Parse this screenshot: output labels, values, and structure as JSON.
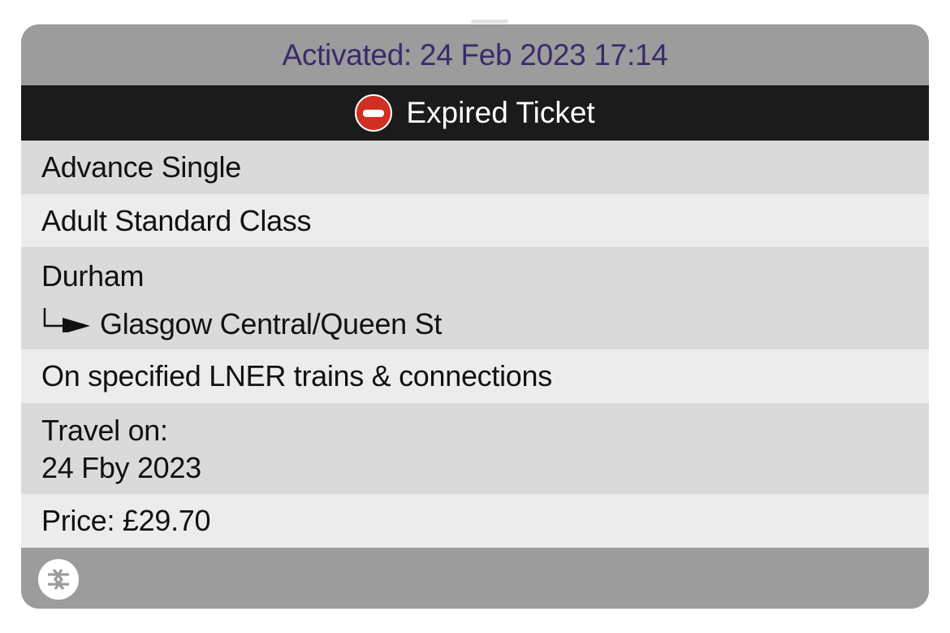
{
  "ticket": {
    "activated": "Activated: 24 Feb 2023 17:14",
    "status": "Expired Ticket",
    "ticket_type": "Advance Single",
    "passenger_class": "Adult Standard Class",
    "origin": "Durham",
    "destination": "Glasgow Central/Queen St",
    "route": "On specified LNER trains & connections",
    "travel_label": "Travel on:",
    "travel_date": "24 Fby 2023",
    "price": "Price: £29.70"
  },
  "icons": {
    "status": "no-entry-icon",
    "route_arrow": "route-arrow-icon",
    "footer": "national-rail-logo"
  },
  "colors": {
    "activated_text": "#3b2a6b",
    "status_bar": "#1b1b1b",
    "no_entry": "#d12f21",
    "frame": "#9c9c9c",
    "row_dark": "#dadada",
    "row_light": "#ececec"
  }
}
